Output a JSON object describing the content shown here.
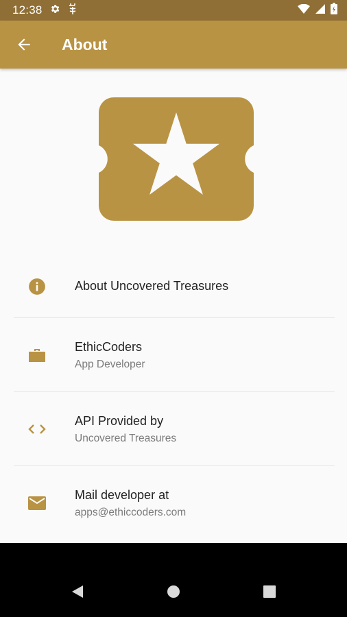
{
  "status_bar": {
    "time": "12:38",
    "icons": [
      "gear-icon",
      "sync-icon",
      "wifi-icon",
      "signal-icon",
      "battery-icon"
    ]
  },
  "app_bar": {
    "back_icon": "arrow-back-icon",
    "title": "About"
  },
  "logo": {
    "icon": "ticket-star-icon",
    "color": "#b99344"
  },
  "items": [
    {
      "icon": "info-icon",
      "primary": "About Uncovered Treasures",
      "secondary": ""
    },
    {
      "icon": "briefcase-icon",
      "primary": "EthicCoders",
      "secondary": "App Developer"
    },
    {
      "icon": "code-icon",
      "primary": "API Provided by",
      "secondary": "Uncovered Treasures"
    },
    {
      "icon": "mail-icon",
      "primary": "Mail developer at",
      "secondary": "apps@ethiccoders.com"
    }
  ],
  "nav_bar": {
    "buttons": [
      "back-triangle-icon",
      "home-circle-icon",
      "recents-square-icon"
    ]
  },
  "colors": {
    "status_bar": "#8f6f35",
    "app_bar": "#b99344",
    "accent": "#b99344",
    "background": "#fafafa"
  }
}
